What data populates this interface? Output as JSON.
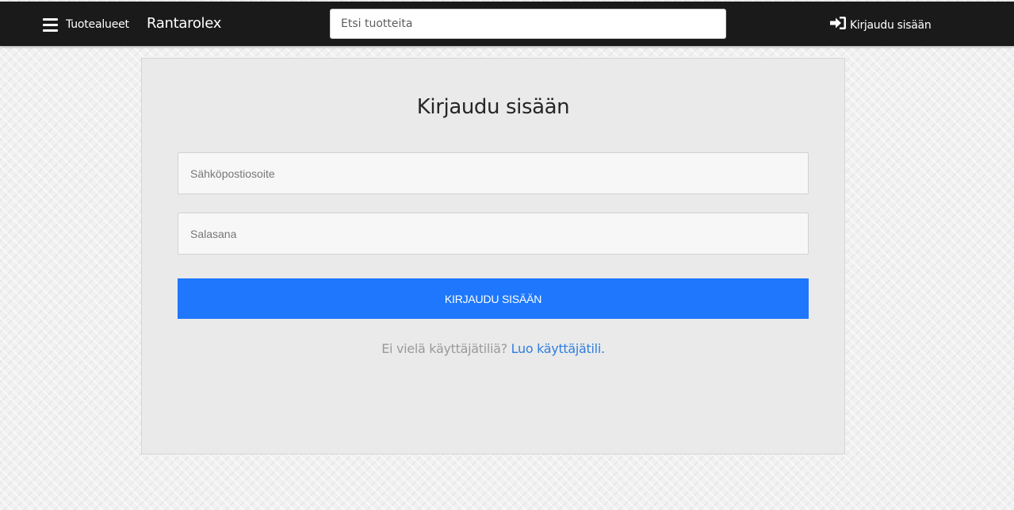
{
  "header": {
    "menu_label": "Tuotealueet",
    "menu_icon": "hamburger-icon",
    "brand": "Rantarolex",
    "search": {
      "placeholder": "Etsi tuotteita",
      "value": ""
    },
    "login_label": "Kirjaudu sisään",
    "login_icon": "sign-in-icon"
  },
  "login_form": {
    "title": "Kirjaudu sisään",
    "email_placeholder": "Sähköpostiosoite",
    "password_placeholder": "Salasana",
    "submit_label": "KIRJAUDU SISÄÄN",
    "signup_prompt": "Ei vielä käyttäjätiliä?",
    "signup_link": "Luo käyttäjätili."
  },
  "colors": {
    "navbar_background": "#1a1a1a",
    "card_background": "#eaeaea",
    "primary_button": "#1e77fd",
    "link": "#2f7fe0"
  }
}
